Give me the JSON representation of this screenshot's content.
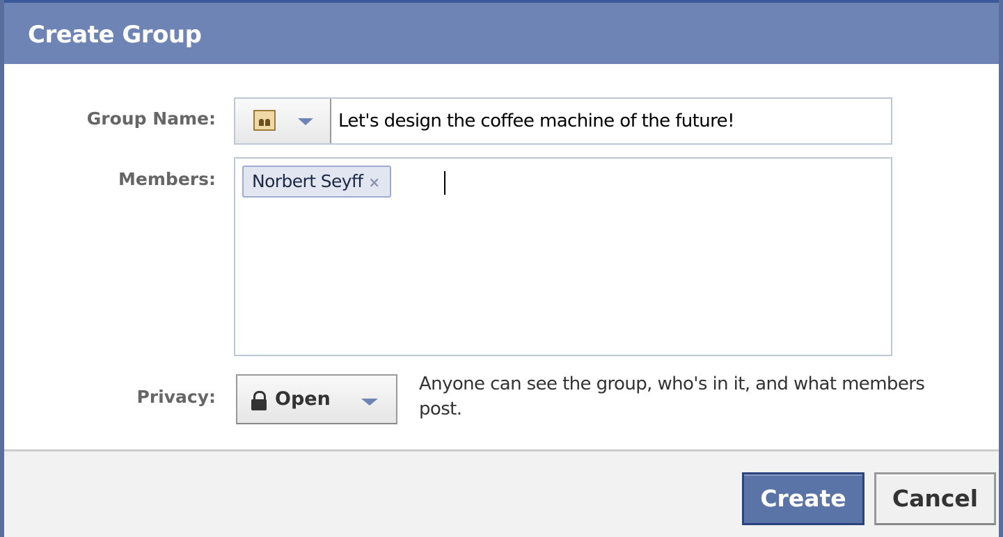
{
  "header": {
    "title": "Create Group"
  },
  "form": {
    "group_name_label": "Group Name:",
    "group_name_value": "Let's design the coffee machine of the future!",
    "members_label": "Members:",
    "members": [
      {
        "name": "Norbert Seyff",
        "remove": "×"
      }
    ],
    "privacy_label": "Privacy:",
    "privacy_value": "Open",
    "privacy_description": "Anyone can see the group, who's in it, and what members post."
  },
  "footer": {
    "create_label": "Create",
    "cancel_label": "Cancel"
  },
  "icons": {
    "group_icon": "group-icon",
    "lock_icon": "lock-icon",
    "dropdown_icon": "chevron-down-icon",
    "remove_icon": "close-icon"
  },
  "colors": {
    "header_bg": "#6d84b4",
    "primary_button": "#5b74a8",
    "token_bg": "#e2e6f0"
  }
}
